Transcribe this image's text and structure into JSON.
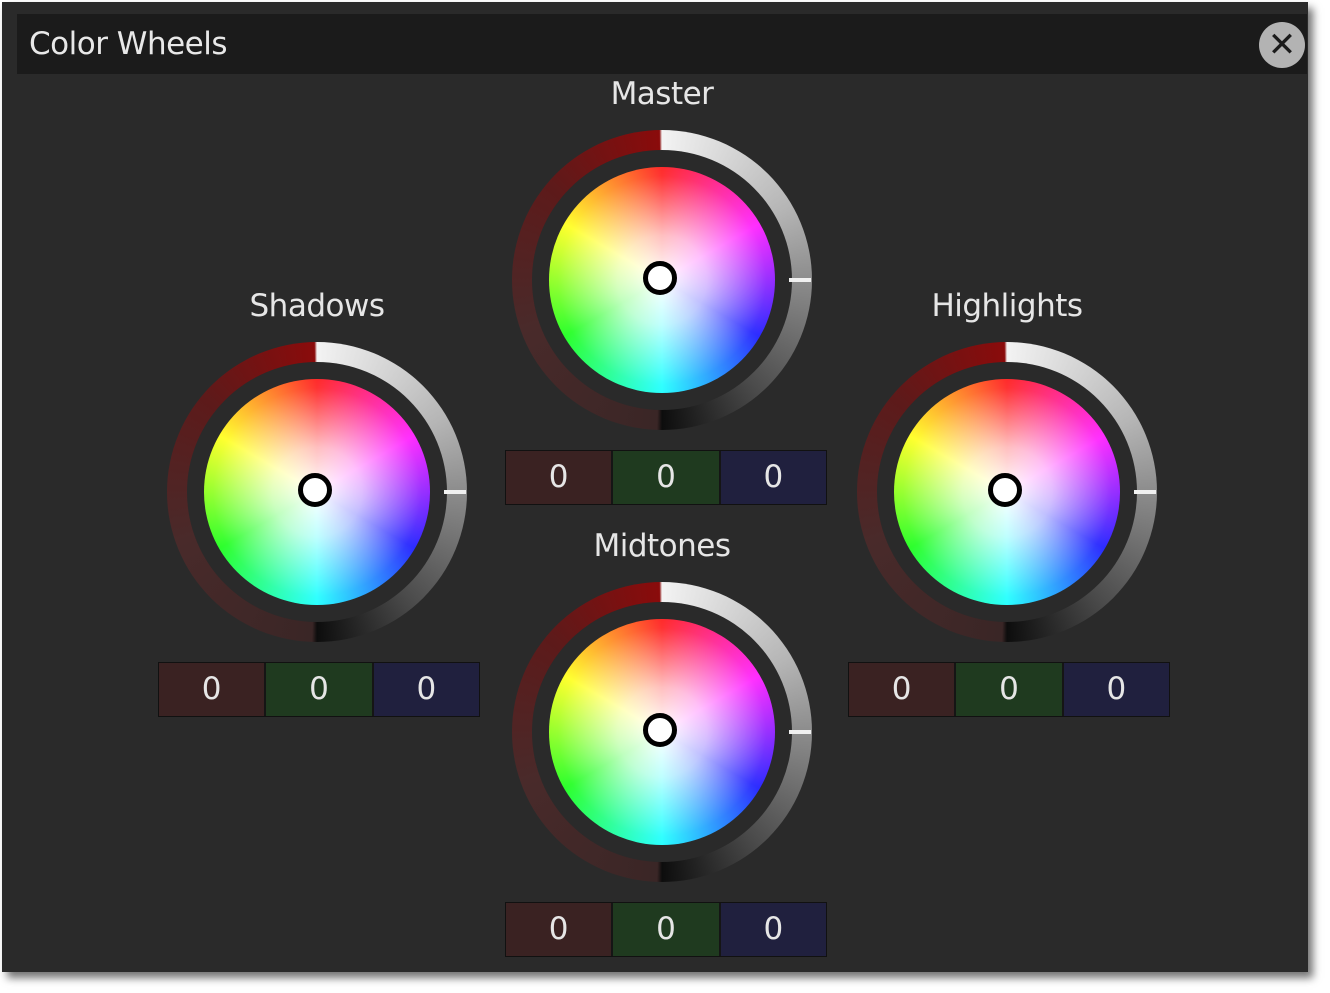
{
  "window": {
    "title": "Color Wheels",
    "close_icon": "close-icon"
  },
  "colors": {
    "panel_bg": "#2a2a2a",
    "titlebar_bg": "#1b1b1b",
    "red_field": "#3a2222",
    "green_field": "#1f3a1f",
    "blue_field": "#20203e"
  },
  "wheels": {
    "master": {
      "label": "Master",
      "r": "0",
      "g": "0",
      "b": "0"
    },
    "shadows": {
      "label": "Shadows",
      "r": "0",
      "g": "0",
      "b": "0"
    },
    "highlights": {
      "label": "Highlights",
      "r": "0",
      "g": "0",
      "b": "0"
    },
    "midtones": {
      "label": "Midtones",
      "r": "0",
      "g": "0",
      "b": "0"
    }
  }
}
